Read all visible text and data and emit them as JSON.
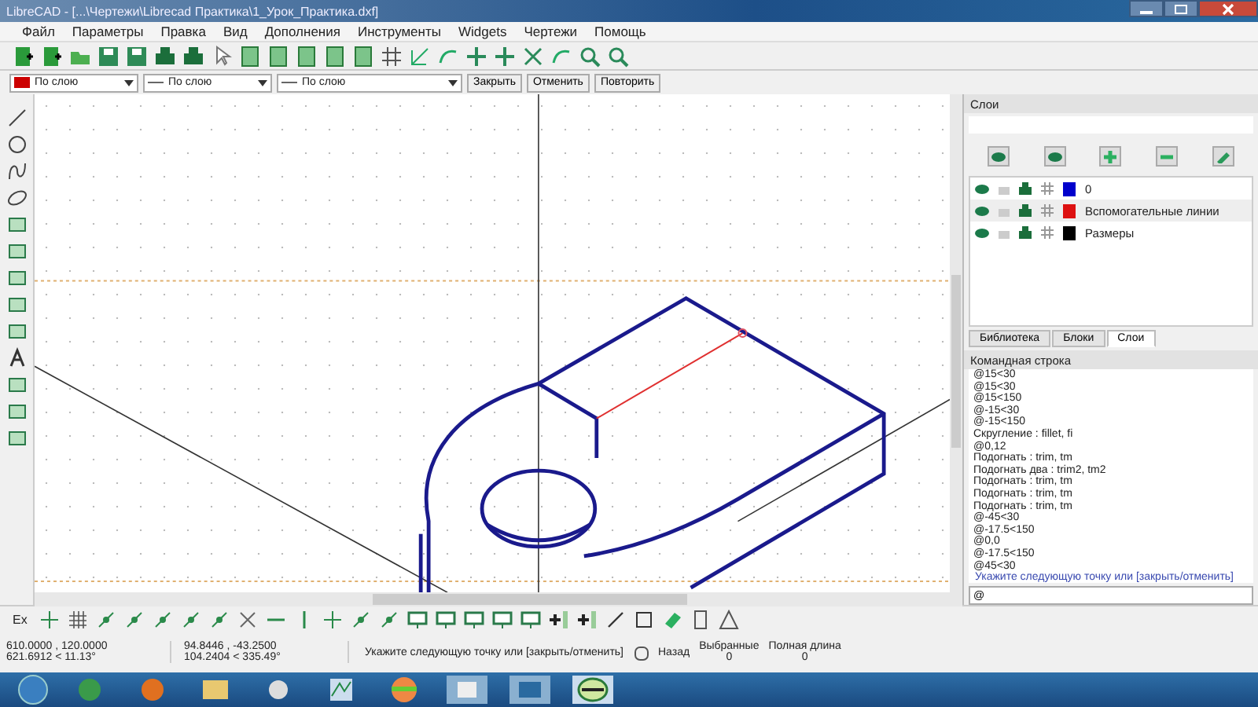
{
  "window": {
    "title": "LibreCAD - [...\\Чертежи\\Librecad Практика\\1_Урок_Практика.dxf]"
  },
  "menu": [
    "Файл",
    "Параметры",
    "Правка",
    "Вид",
    "Дополнения",
    "Инструменты",
    "Widgets",
    "Чертежи",
    "Помощь"
  ],
  "pen_toolbar": {
    "pen_color": "По слою",
    "width": "По слою",
    "type": "По слою",
    "buttons": [
      "Закрыть",
      "Отменить",
      "Повторить"
    ]
  },
  "layers_panel": {
    "title": "Слои",
    "layers": [
      {
        "name": "0",
        "color": "#0000cc"
      },
      {
        "name": "Вспомогательные линии",
        "color": "#dd1111"
      },
      {
        "name": "Размеры",
        "color": "#000000"
      }
    ],
    "tabs": [
      {
        "label": "Библиотека",
        "selected": false
      },
      {
        "label": "Блоки",
        "selected": false
      },
      {
        "label": "Слои",
        "selected": true
      }
    ]
  },
  "command_panel": {
    "title": "Командная строка",
    "history": [
      "@15<30",
      "@15<30",
      "@15<150",
      "@-15<30",
      "@-15<150",
      "Скругление : fillet, fi",
      "@0,12",
      "Подогнать : trim, tm",
      "Подогнать два : trim2, tm2",
      "Подогнать : trim, tm",
      "Подогнать : trim, tm",
      "Подогнать : trim, tm",
      "@-45<30",
      "@-17.5<150",
      "@0,0",
      "@-17.5<150",
      "@45<30"
    ],
    "prompt": "Укажите следующую точку или [закрыть/отменить]",
    "input": "@"
  },
  "snap_toolbar": {
    "label": "Ex"
  },
  "status_bar": {
    "absolute": [
      "610.0000 , 120.0000",
      "621.6912 < 11.13°"
    ],
    "relative": [
      "94.8446 , -43.2500",
      "104.2404 < 335.49°"
    ],
    "prompt": "Укажите следующую точку или [закрыть/отменить]",
    "back": "Назад",
    "selected_label": "Выбранные",
    "selected_value": "0",
    "length_label": "Полная длина",
    "length_value": "0"
  }
}
